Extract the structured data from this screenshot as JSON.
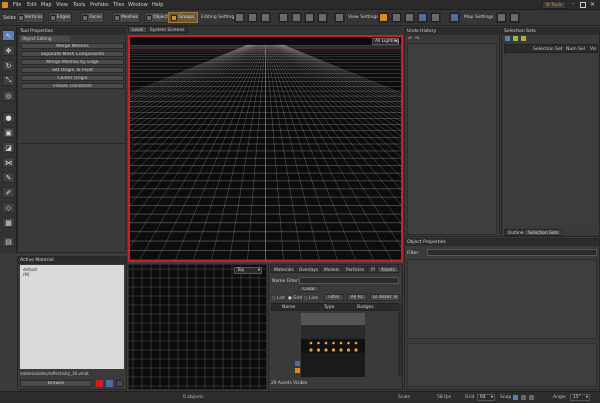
{
  "menu": [
    "File",
    "Edit",
    "Map",
    "View",
    "Tools",
    "Prefabs",
    "Tiles",
    "Window",
    "Help"
  ],
  "tools_button": "Tools",
  "toolbar": {
    "select_label": "Select",
    "vertices": "Vertices",
    "edges": "Edges",
    "faces": "Faces",
    "tiles": "Tiles",
    "meshes": "Meshes",
    "objects": "Objects",
    "groups": "Groups",
    "editing_settings": "Editing Settings",
    "view_settings": "View Settings",
    "map_settings": "Map Settings"
  },
  "tool_properties": {
    "title": "Tool Properties",
    "tab": "Object Editing",
    "buttons": [
      "Merge Meshes",
      "Separate Mesh Components",
      "Merge Meshes by Edge",
      "Set Origin To Pivot",
      "Center Origin",
      "Freeze Transform"
    ]
  },
  "viewport": {
    "tabs": [
      "Level",
      "System Screens"
    ],
    "lighting": "All Lighting"
  },
  "undo_history": {
    "title": "Undo History"
  },
  "selection_sets": {
    "title": "Selection Sets",
    "columns": [
      "Selection Set",
      "Num",
      "Sel",
      "Vis"
    ],
    "tabs": [
      "Outliner",
      "Selection Sets"
    ]
  },
  "object_properties": {
    "title": "Object Properties",
    "filter_label": "Filter:"
  },
  "active_material": {
    "title": "Active Material",
    "name_line1": "default",
    "name_line2": "(M)",
    "path": "materials/dev/reflectivity_30.vmat",
    "browse": "Browse"
  },
  "small_viewport": {
    "view": "Top"
  },
  "asset_browser": {
    "tabs": [
      "Materials",
      "Overlays",
      "Models",
      "Particles",
      "P/",
      "Assets"
    ],
    "name_filter_label": "Name Filter:",
    "clear": "Clear",
    "radios": [
      "List",
      "Grid",
      "Line"
    ],
    "filter_btn": "Filter",
    "size_btn": "All Rc",
    "more_btn": "Lil Asset To",
    "columns": [
      "Name",
      "Type",
      "Badges"
    ],
    "count": "29 Assets Visible"
  },
  "status_bar": {
    "objects": "0 objects",
    "scale_label": "Scale",
    "fps": "58 fps",
    "grid_label": "Grid",
    "grid_value": "64",
    "snap_label": "Snap",
    "angle_label": "Angle",
    "angle_value": "15°"
  },
  "colors": {
    "accent_blue": "#5a7fb5",
    "selection_red": "#c8202a",
    "tools_orange": "#e08a1e",
    "grid_green": "#2fbf6a",
    "grid_red": "#c43030"
  }
}
